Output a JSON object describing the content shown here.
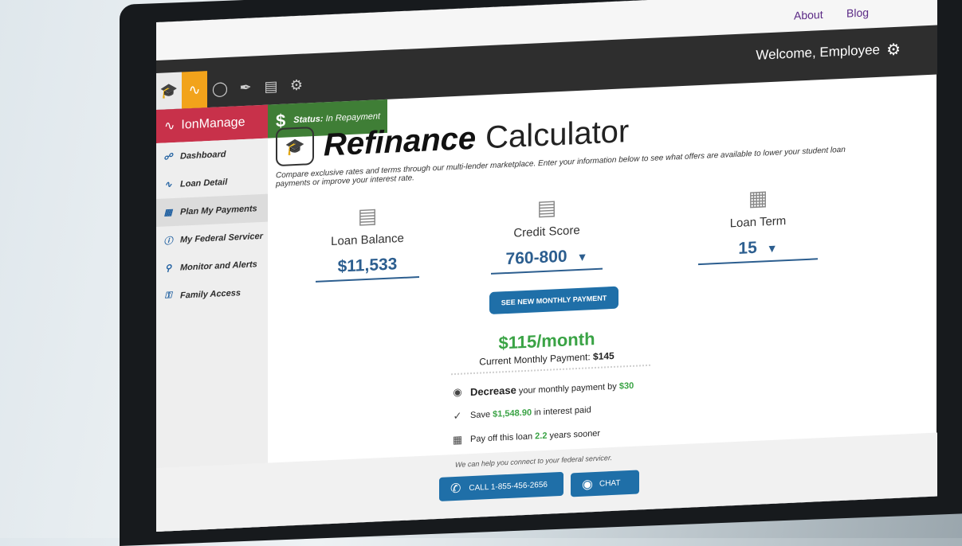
{
  "topnav": {
    "about": "About",
    "blog": "Blog"
  },
  "header": {
    "welcome": "Welcome, Employee",
    "brand": "IonManage",
    "status_prefix": "Status:",
    "status_value": "In Repayment"
  },
  "icons": [
    "graduation-cap-icon",
    "pulse-icon",
    "coin-icon",
    "broom-icon",
    "document-icon",
    "gear-blob-icon"
  ],
  "sidebar": {
    "items": [
      {
        "label": "Dashboard",
        "icon": "dashboard-icon"
      },
      {
        "label": "Loan Detail",
        "icon": "pulse-icon"
      },
      {
        "label": "Plan My Payments",
        "icon": "calendar-icon"
      },
      {
        "label": "My Federal Servicer",
        "icon": "info-icon"
      },
      {
        "label": "Monitor and Alerts",
        "icon": "search-icon"
      },
      {
        "label": "Family Access",
        "icon": "key-icon"
      }
    ]
  },
  "main": {
    "title_bold": "Refinance",
    "title_light": "Calculator",
    "description": "Compare exclusive rates and terms through our multi-lender marketplace. Enter your information below to see what offers are available to lower your student loan payments or improve your interest rate.",
    "loan_balance_label": "Loan Balance",
    "loan_balance_value": "$11,533",
    "credit_score_label": "Credit Score",
    "credit_score_value": "760-800",
    "loan_term_label": "Loan Term",
    "loan_term_value": "15",
    "cta_label": "SEE NEW MONTHLY PAYMENT",
    "monthly": "$115/month",
    "current_prefix": "Current Monthly Payment:",
    "current_value": "$145",
    "decrease_bold": "Decrease",
    "decrease_text": "your monthly payment by",
    "decrease_value": "$30",
    "save_prefix": "Save",
    "save_value": "$1,548.90",
    "save_suffix": "in interest paid",
    "payoff_prefix": "Pay off this loan",
    "payoff_value": "2.2",
    "payoff_suffix": "years sooner"
  },
  "footer": {
    "help": "We can help you connect to your federal servicer.",
    "call": "CALL 1-855-456-2656",
    "chat": "CHAT"
  },
  "colors": {
    "brand": "#c8314a",
    "status": "#3f7e36",
    "accent": "#1f6fa8",
    "highlight": "#3aa345",
    "orange": "#f2a31b"
  }
}
